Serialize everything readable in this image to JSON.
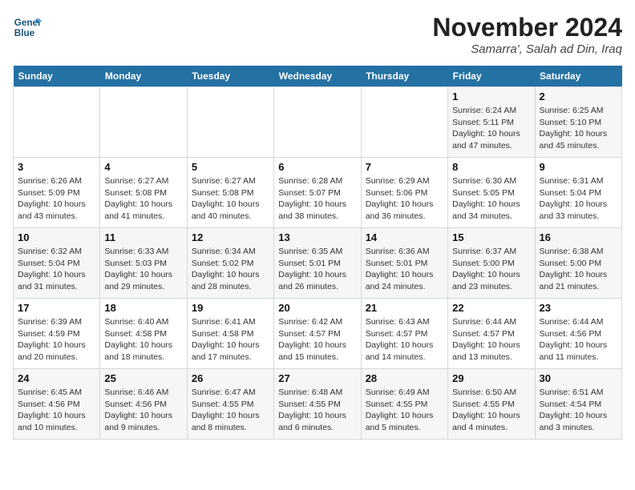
{
  "logo": {
    "line1": "General",
    "line2": "Blue"
  },
  "title": "November 2024",
  "subtitle": "Samarra', Salah ad Din, Iraq",
  "days_of_week": [
    "Sunday",
    "Monday",
    "Tuesday",
    "Wednesday",
    "Thursday",
    "Friday",
    "Saturday"
  ],
  "weeks": [
    [
      {
        "num": "",
        "info": ""
      },
      {
        "num": "",
        "info": ""
      },
      {
        "num": "",
        "info": ""
      },
      {
        "num": "",
        "info": ""
      },
      {
        "num": "",
        "info": ""
      },
      {
        "num": "1",
        "info": "Sunrise: 6:24 AM\nSunset: 5:11 PM\nDaylight: 10 hours and 47 minutes."
      },
      {
        "num": "2",
        "info": "Sunrise: 6:25 AM\nSunset: 5:10 PM\nDaylight: 10 hours and 45 minutes."
      }
    ],
    [
      {
        "num": "3",
        "info": "Sunrise: 6:26 AM\nSunset: 5:09 PM\nDaylight: 10 hours and 43 minutes."
      },
      {
        "num": "4",
        "info": "Sunrise: 6:27 AM\nSunset: 5:08 PM\nDaylight: 10 hours and 41 minutes."
      },
      {
        "num": "5",
        "info": "Sunrise: 6:27 AM\nSunset: 5:08 PM\nDaylight: 10 hours and 40 minutes."
      },
      {
        "num": "6",
        "info": "Sunrise: 6:28 AM\nSunset: 5:07 PM\nDaylight: 10 hours and 38 minutes."
      },
      {
        "num": "7",
        "info": "Sunrise: 6:29 AM\nSunset: 5:06 PM\nDaylight: 10 hours and 36 minutes."
      },
      {
        "num": "8",
        "info": "Sunrise: 6:30 AM\nSunset: 5:05 PM\nDaylight: 10 hours and 34 minutes."
      },
      {
        "num": "9",
        "info": "Sunrise: 6:31 AM\nSunset: 5:04 PM\nDaylight: 10 hours and 33 minutes."
      }
    ],
    [
      {
        "num": "10",
        "info": "Sunrise: 6:32 AM\nSunset: 5:04 PM\nDaylight: 10 hours and 31 minutes."
      },
      {
        "num": "11",
        "info": "Sunrise: 6:33 AM\nSunset: 5:03 PM\nDaylight: 10 hours and 29 minutes."
      },
      {
        "num": "12",
        "info": "Sunrise: 6:34 AM\nSunset: 5:02 PM\nDaylight: 10 hours and 28 minutes."
      },
      {
        "num": "13",
        "info": "Sunrise: 6:35 AM\nSunset: 5:01 PM\nDaylight: 10 hours and 26 minutes."
      },
      {
        "num": "14",
        "info": "Sunrise: 6:36 AM\nSunset: 5:01 PM\nDaylight: 10 hours and 24 minutes."
      },
      {
        "num": "15",
        "info": "Sunrise: 6:37 AM\nSunset: 5:00 PM\nDaylight: 10 hours and 23 minutes."
      },
      {
        "num": "16",
        "info": "Sunrise: 6:38 AM\nSunset: 5:00 PM\nDaylight: 10 hours and 21 minutes."
      }
    ],
    [
      {
        "num": "17",
        "info": "Sunrise: 6:39 AM\nSunset: 4:59 PM\nDaylight: 10 hours and 20 minutes."
      },
      {
        "num": "18",
        "info": "Sunrise: 6:40 AM\nSunset: 4:58 PM\nDaylight: 10 hours and 18 minutes."
      },
      {
        "num": "19",
        "info": "Sunrise: 6:41 AM\nSunset: 4:58 PM\nDaylight: 10 hours and 17 minutes."
      },
      {
        "num": "20",
        "info": "Sunrise: 6:42 AM\nSunset: 4:57 PM\nDaylight: 10 hours and 15 minutes."
      },
      {
        "num": "21",
        "info": "Sunrise: 6:43 AM\nSunset: 4:57 PM\nDaylight: 10 hours and 14 minutes."
      },
      {
        "num": "22",
        "info": "Sunrise: 6:44 AM\nSunset: 4:57 PM\nDaylight: 10 hours and 13 minutes."
      },
      {
        "num": "23",
        "info": "Sunrise: 6:44 AM\nSunset: 4:56 PM\nDaylight: 10 hours and 11 minutes."
      }
    ],
    [
      {
        "num": "24",
        "info": "Sunrise: 6:45 AM\nSunset: 4:56 PM\nDaylight: 10 hours and 10 minutes."
      },
      {
        "num": "25",
        "info": "Sunrise: 6:46 AM\nSunset: 4:56 PM\nDaylight: 10 hours and 9 minutes."
      },
      {
        "num": "26",
        "info": "Sunrise: 6:47 AM\nSunset: 4:55 PM\nDaylight: 10 hours and 8 minutes."
      },
      {
        "num": "27",
        "info": "Sunrise: 6:48 AM\nSunset: 4:55 PM\nDaylight: 10 hours and 6 minutes."
      },
      {
        "num": "28",
        "info": "Sunrise: 6:49 AM\nSunset: 4:55 PM\nDaylight: 10 hours and 5 minutes."
      },
      {
        "num": "29",
        "info": "Sunrise: 6:50 AM\nSunset: 4:55 PM\nDaylight: 10 hours and 4 minutes."
      },
      {
        "num": "30",
        "info": "Sunrise: 6:51 AM\nSunset: 4:54 PM\nDaylight: 10 hours and 3 minutes."
      }
    ]
  ]
}
